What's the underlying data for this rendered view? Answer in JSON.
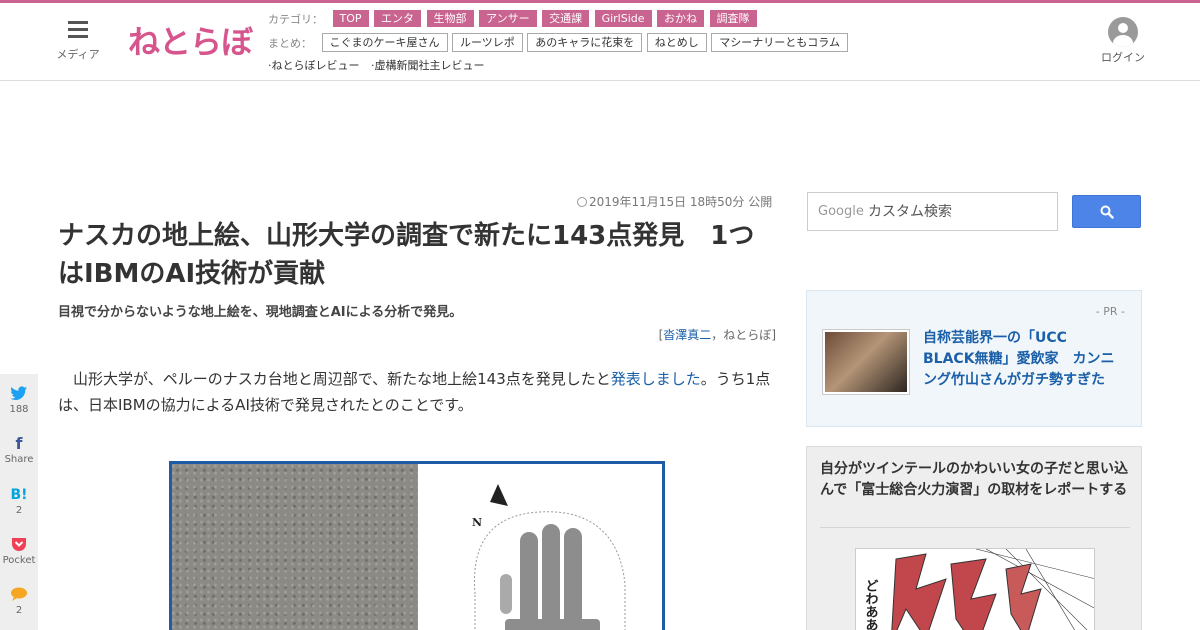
{
  "header": {
    "menu_label": "メディア",
    "logo": "ねとらぼ",
    "category_header": "カテゴリ：",
    "categories": [
      "TOP",
      "エンタ",
      "生物部",
      "アンサー",
      "交通課",
      "GirlSide",
      "おかね",
      "調査隊"
    ],
    "matome_header": "まとめ：",
    "matome": [
      "こぐまのケーキ屋さん",
      "ルーツレポ",
      "あのキャラに花束を",
      "ねとめし",
      "マシーナリーともコラム"
    ],
    "reviews": [
      "·ねとらぼレビュー",
      "·虚構新聞社主レビュー"
    ],
    "login_label": "ログイン"
  },
  "article": {
    "date": "2019年11月15日 18時50分 公開",
    "title": "ナスカの地上絵、山形大学の調査で新たに143点発見　1つはIBMのAI技術が貢献",
    "subtitle": "目視で分からないような地上絵を、現地調査とAIによる分析で発見。",
    "byline_open": "[",
    "author": "沓澤真二",
    "byline_sep": "，",
    "source": "ねとらぼ",
    "byline_close": "]",
    "body_part1": "　山形大学が、ペルーのナスカ台地と周辺部で、新たな地上絵143点を発見したと",
    "body_link": "発表しました",
    "body_part2": "。うち1点は、日本IBMの協力によるAI技術で発見されたとのことです。"
  },
  "share": [
    {
      "icon": "twitter-icon",
      "glyph": "🐦",
      "count": "188",
      "color": "#1da1f2"
    },
    {
      "icon": "facebook-icon",
      "glyph": "f",
      "count": "Share",
      "color": "#3b5998"
    },
    {
      "icon": "hatena-icon",
      "glyph": "B!",
      "count": "2",
      "color": "#00a4de"
    },
    {
      "icon": "pocket-icon",
      "glyph": "◆",
      "count": "Pocket",
      "color": "#ef4056"
    },
    {
      "icon": "comment-icon",
      "glyph": "●",
      "count": "2",
      "color": "#f5a623"
    }
  ],
  "sidebar": {
    "search_logo": "Google",
    "search_placeholder": "カスタム検索",
    "pr_tag": "- PR -",
    "pr_text": "自称芸能界一の「UCC BLACK無糖」愛飲家　カンニング竹山さんがガチ勢すぎた",
    "feature_text": "自分がツインテールのかわいい女の子だと思い込んで「富士総合火力演習」の取材をレポートする",
    "manga_text": "どわああ"
  },
  "colors": {
    "brand": "#c9638f",
    "link": "#1a5fa8",
    "search_button": "#4d84e8",
    "figure_border": "#1f5ba6"
  }
}
